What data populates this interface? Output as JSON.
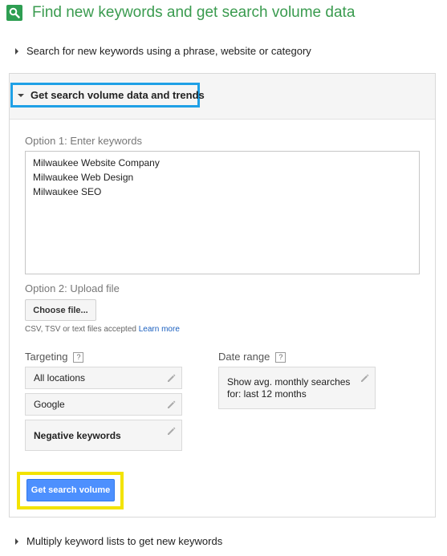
{
  "header": {
    "title": "Find new keywords and get search volume data",
    "icon": "search-icon",
    "brand_color": "#2e9e52"
  },
  "sections": {
    "search_new": "Search for new keywords using a phrase, website or category",
    "get_volume": "Get search volume data and trends",
    "multiply": "Multiply keyword lists to get new keywords"
  },
  "option1": {
    "label": "Option 1: Enter keywords",
    "keywords": [
      "Milwaukee Website Company",
      "Milwaukee Web Design",
      "Milwaukee SEO"
    ]
  },
  "option2": {
    "label": "Option 2: Upload file",
    "choose_file": "Choose file...",
    "hint": "CSV, TSV or text files accepted",
    "learn_more": "Learn more"
  },
  "targeting": {
    "label": "Targeting",
    "help": "?",
    "locations": "All locations",
    "network": "Google",
    "negative": "Negative keywords"
  },
  "date_range": {
    "label": "Date range",
    "help": "?",
    "value": "Show avg. monthly searches for: last 12 months"
  },
  "submit": {
    "label": "Get search volume",
    "color": "#4d90fe"
  },
  "highlights": {
    "blue": "#1fa0e6",
    "yellow": "#f3e300"
  }
}
